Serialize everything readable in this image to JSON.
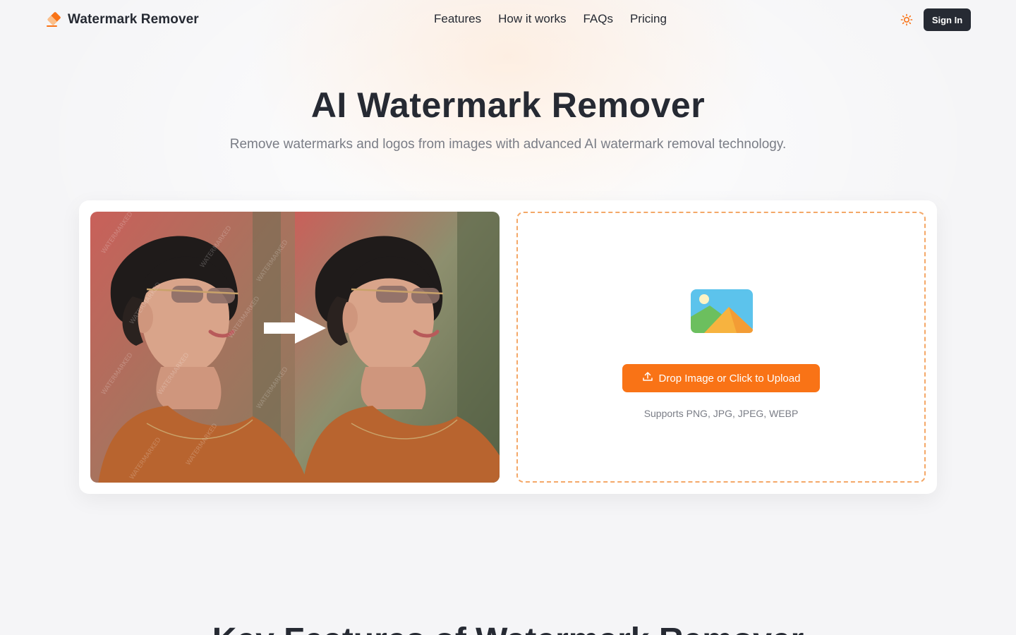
{
  "brand": {
    "name": "Watermark Remover",
    "icon": "eraser-icon",
    "accent": "#f97316"
  },
  "nav": {
    "items": [
      "Features",
      "How it works",
      "FAQs",
      "Pricing"
    ]
  },
  "header": {
    "theme_icon": "sun-icon",
    "signin_label": "Sign In"
  },
  "hero": {
    "title": "AI Watermark Remover",
    "subtitle": "Remove watermarks and logos from images with advanced AI watermark removal technology."
  },
  "demo": {
    "watermark_text": "WATERMARKED",
    "arrow_icon": "arrow-right-icon"
  },
  "upload": {
    "illustration": "image-placeholder-icon",
    "button_icon": "upload-icon",
    "button_label": "Drop Image or Click to Upload",
    "hint": "Supports PNG, JPG, JPEG, WEBP"
  },
  "features": {
    "title": "Key Features of Watermark Remover"
  }
}
